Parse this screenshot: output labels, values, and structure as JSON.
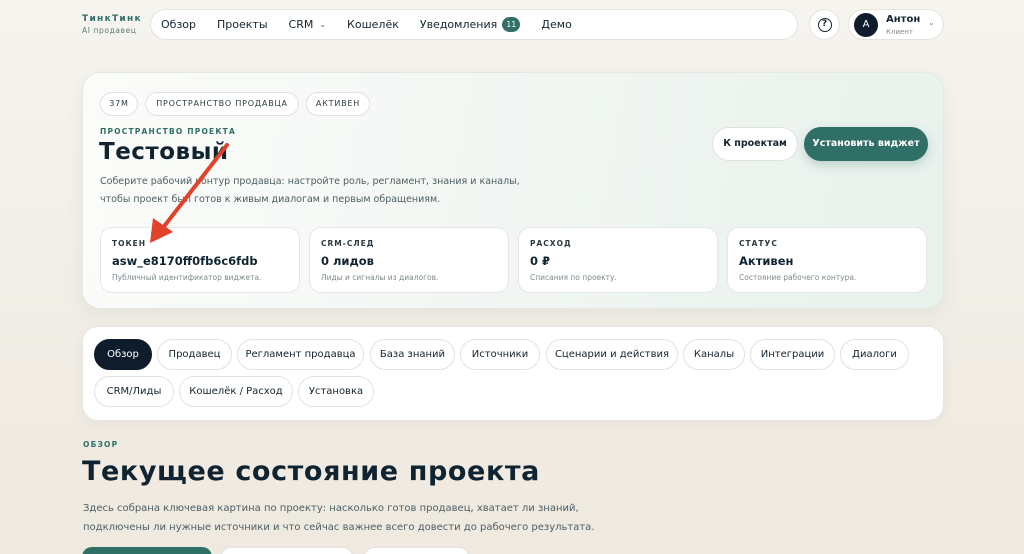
{
  "brand": {
    "name": "ТинкТинк",
    "subtitle": "AI продавец"
  },
  "nav": {
    "items": [
      "Обзор",
      "Проекты",
      "CRM",
      "Кошелёк",
      "Уведомления",
      "Демо"
    ],
    "notifications_count": "11"
  },
  "user": {
    "avatar_letter": "А",
    "name": "Антон",
    "role": "Клиент"
  },
  "project": {
    "chips": [
      "37M",
      "ПРОСТРАНСТВО ПРОДАВЦА",
      "АКТИВЕН"
    ],
    "kicker": "ПРОСТРАНСТВО ПРОЕКТА",
    "title": "Тестовый",
    "description": "Соберите рабочий контур продавца: настройте роль, регламент, знания и каналы, чтобы проект был готов к живым диалогам и первым обращениям.",
    "back_button": "К проектам",
    "install_button": "Установить виджет",
    "stats": [
      {
        "label": "ТОКЕН",
        "value": "asw_e8170ff0fb6c6fdb",
        "note": "Публичный идентификатор виджета."
      },
      {
        "label": "CRM-СЛЕД",
        "value": "0 лидов",
        "note": "Лиды и сигналы из диалогов."
      },
      {
        "label": "РАСХОД",
        "value": "0 ₽",
        "note": "Списания по проекту."
      },
      {
        "label": "СТАТУС",
        "value": "Активен",
        "note": "Состояние рабочего контура."
      }
    ]
  },
  "tabs": [
    "Обзор",
    "Продавец",
    "Регламент продавца",
    "База знаний",
    "Источники",
    "Сценарии и действия",
    "Каналы",
    "Интеграции",
    "Диалоги",
    "CRM/Лиды",
    "Кошелёк / Расход",
    "Установка"
  ],
  "active_tab": "Обзор",
  "overview": {
    "kicker": "ОБЗОР",
    "title": "Текущее состояние проекта",
    "description": "Здесь собрана ключевая картина по проекту: насколько готов продавец, хватает ли знаний, подключены ли нужные источники и что сейчас важнее всего довести до рабочего результата."
  },
  "colors": {
    "accent": "#2f6f66",
    "dark": "#0f1c2c",
    "annotation": "#e2412b"
  }
}
